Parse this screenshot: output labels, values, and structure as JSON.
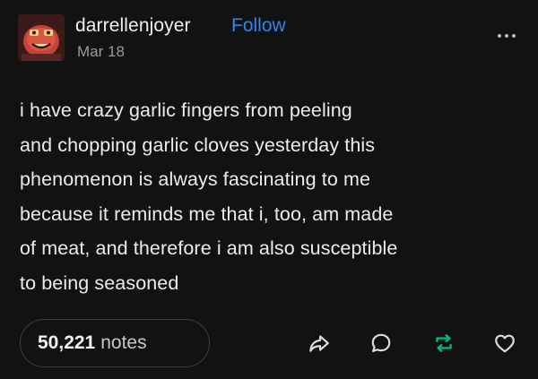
{
  "post": {
    "username": "darrellenjoyer",
    "follow_label": "Follow",
    "date": "Mar 18",
    "lines": [
      "i have crazy garlic fingers from peeling",
      "and chopping garlic cloves yesterday this",
      "phenomenon is always fascinating to me",
      "because it reminds me that i, too, am made",
      "of meat, and therefore i am also susceptible",
      "to being seasoned"
    ],
    "notes_count": "50,221",
    "notes_label": "notes"
  },
  "icons": {
    "avatar": "avatar-image",
    "more": "more-dots-icon",
    "share": "share-icon",
    "reply": "reply-icon",
    "reblog": "reblog-icon",
    "like": "heart-icon"
  },
  "colors": {
    "background": "#121213",
    "follow": "#2f87e8",
    "reblog": "#00b86b"
  }
}
